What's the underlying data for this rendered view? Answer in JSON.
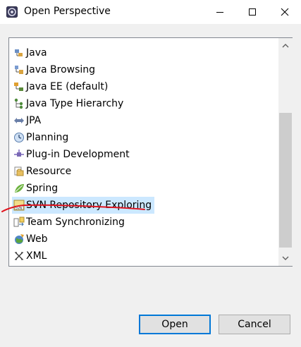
{
  "window": {
    "title": "Open Perspective"
  },
  "perspectives": [
    {
      "label": "Java",
      "icon": "java-perspective-icon",
      "selected": false
    },
    {
      "label": "Java Browsing",
      "icon": "java-browsing-icon",
      "selected": false
    },
    {
      "label": "Java EE (default)",
      "icon": "java-ee-icon",
      "selected": false
    },
    {
      "label": "Java Type Hierarchy",
      "icon": "type-hierarchy-icon",
      "selected": false
    },
    {
      "label": "JPA",
      "icon": "jpa-icon",
      "selected": false
    },
    {
      "label": "Planning",
      "icon": "planning-icon",
      "selected": false
    },
    {
      "label": "Plug-in Development",
      "icon": "plugin-icon",
      "selected": false
    },
    {
      "label": "Resource",
      "icon": "resource-icon",
      "selected": false
    },
    {
      "label": "Spring",
      "icon": "spring-icon",
      "selected": false
    },
    {
      "label": "SVN Repository Exploring",
      "icon": "svn-icon",
      "selected": true
    },
    {
      "label": "Team Synchronizing",
      "icon": "team-sync-icon",
      "selected": false
    },
    {
      "label": "Web",
      "icon": "web-icon",
      "selected": false
    },
    {
      "label": "XML",
      "icon": "xml-icon",
      "selected": false
    }
  ],
  "buttons": {
    "open": "Open",
    "cancel": "Cancel"
  },
  "colors": {
    "selection": "#cce8ff",
    "default_button_border": "#0078d7",
    "annotation_stroke": "#e0141e"
  }
}
